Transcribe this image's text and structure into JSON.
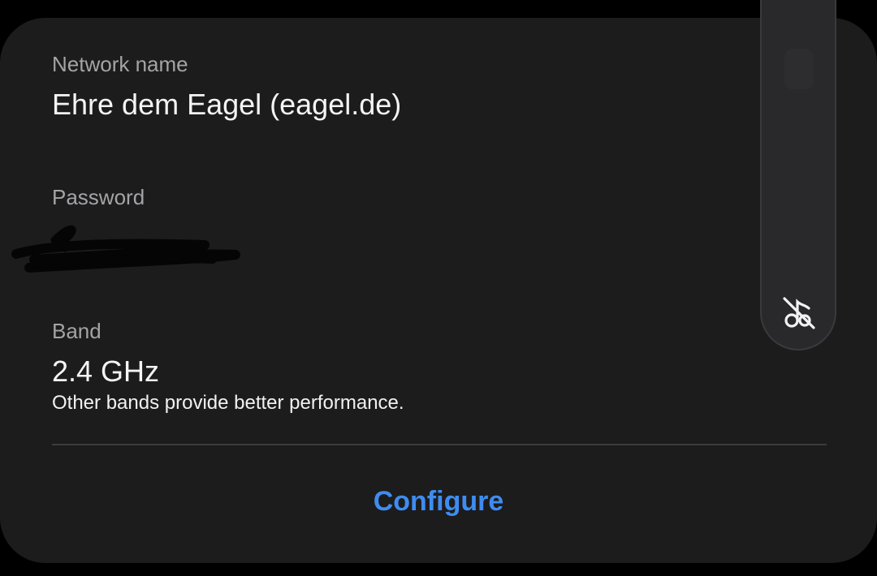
{
  "network": {
    "label": "Network name",
    "value": "Ehre dem Eagel (eagel.de)"
  },
  "password": {
    "label": "Password"
  },
  "band": {
    "label": "Band",
    "value": "2.4 GHz",
    "note": "Other bands provide better performance."
  },
  "actions": {
    "configure_label": "Configure"
  },
  "volume": {
    "icon": "music-off-icon"
  },
  "colors": {
    "background": "#000000",
    "card": "#1c1c1d",
    "accent": "#3f8cf0",
    "label": "#a4a4a6",
    "text": "#f4f4f5"
  }
}
